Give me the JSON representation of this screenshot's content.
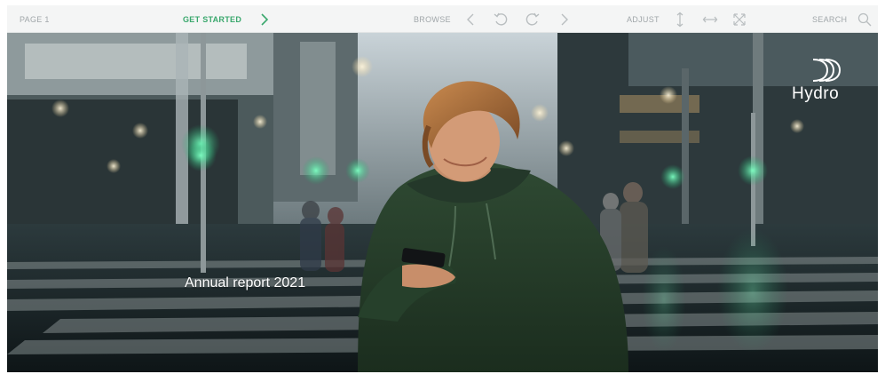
{
  "toolbar": {
    "page_label": "PAGE 1",
    "get_started_label": "GET STARTED",
    "browse_label": "BROWSE",
    "adjust_label": "ADJUST",
    "search_label": "SEARCH",
    "icons": {
      "get_started": "chevron-right-icon",
      "prev": "chevron-left-icon",
      "undo": "undo-icon",
      "redo": "redo-icon",
      "next": "chevron-right-icon",
      "fit_height": "fit-height-icon",
      "fit_width": "fit-width-icon",
      "fullscreen": "expand-icon",
      "search": "search-icon"
    },
    "accent_color": "#3aa86d"
  },
  "cover": {
    "title": "Annual report 2021",
    "brand": "Hydro"
  }
}
